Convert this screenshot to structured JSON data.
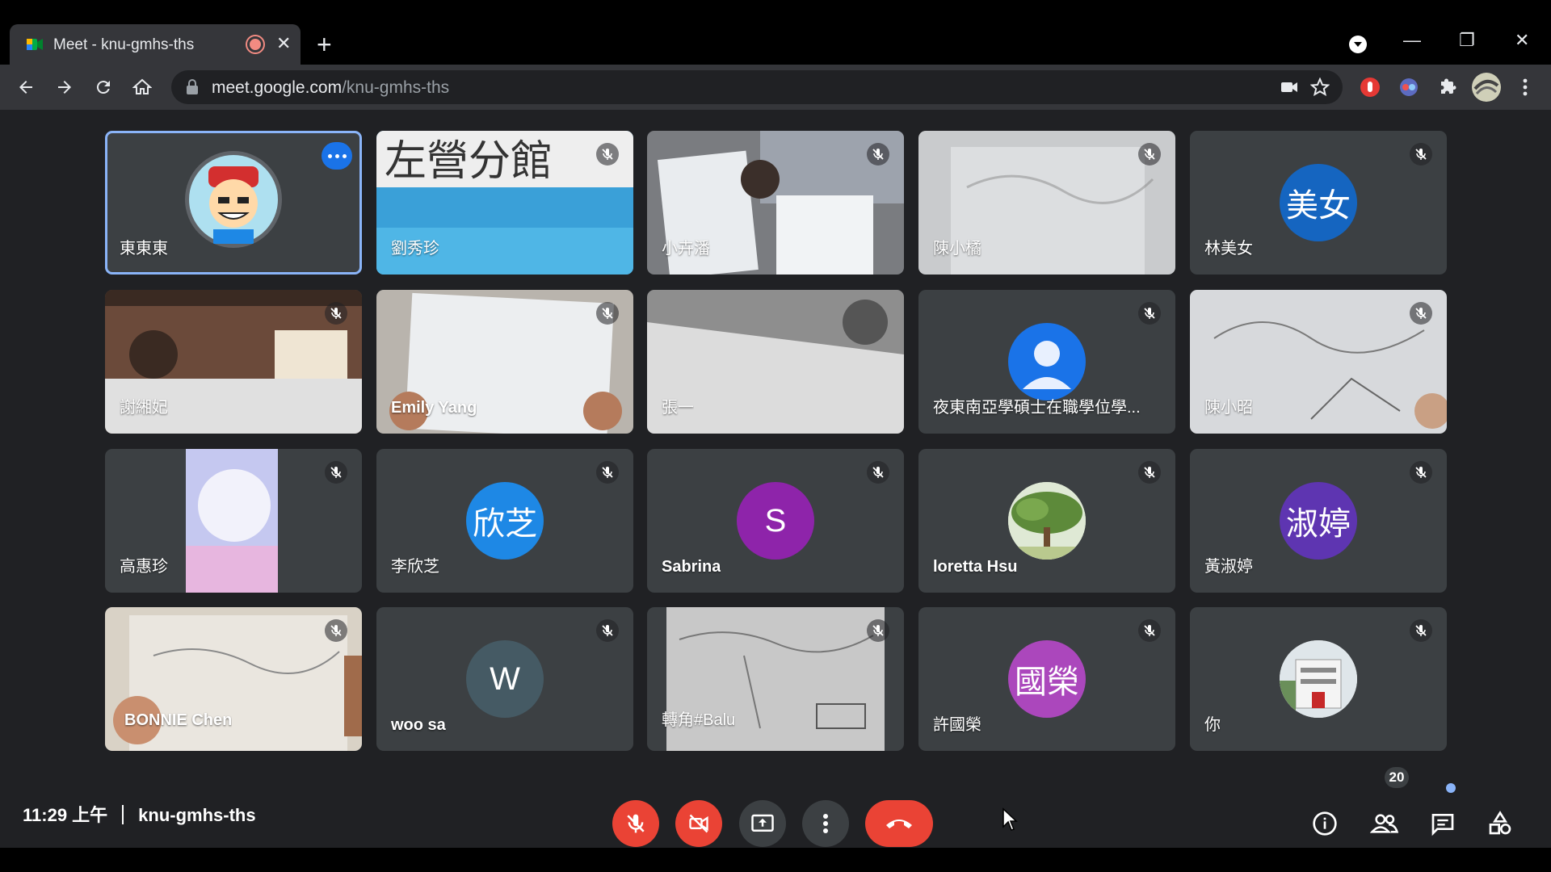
{
  "browser": {
    "tab_title": "Meet - knu-gmhs-ths",
    "tab_close": "✕",
    "new_tab": "+",
    "url_host": "meet.google.com",
    "url_path": "/knu-gmhs-ths",
    "window_controls": {
      "minimize": "—",
      "restore": "❐",
      "close": "✕"
    }
  },
  "participants": [
    {
      "name": "東東東",
      "muted": false,
      "active": true,
      "feed": "avatar-image"
    },
    {
      "name": "劉秀珍",
      "muted": true,
      "feed": "video"
    },
    {
      "name": "小卉潘",
      "muted": true,
      "feed": "video"
    },
    {
      "name": "陳小橘",
      "muted": true,
      "feed": "video"
    },
    {
      "name": "林美女",
      "muted": true,
      "feed": "initials",
      "initials": "美女",
      "color": "#1565c0"
    },
    {
      "name": "謝緗妃",
      "muted": true,
      "feed": "video"
    },
    {
      "name": "Emily Yang",
      "muted": true,
      "feed": "video"
    },
    {
      "name": "張一",
      "muted": false,
      "feed": "video"
    },
    {
      "name": "夜東南亞學碩士在職學位學...",
      "muted": true,
      "feed": "placeholder",
      "color": "#1a73e8"
    },
    {
      "name": "陳小昭",
      "muted": true,
      "feed": "video"
    },
    {
      "name": "高惠珍",
      "muted": true,
      "feed": "video"
    },
    {
      "name": "李欣芝",
      "muted": true,
      "feed": "initials",
      "initials": "欣芝",
      "color": "#1e88e5"
    },
    {
      "name": "Sabrina",
      "muted": true,
      "feed": "initials",
      "initials": "S",
      "color": "#8e24aa"
    },
    {
      "name": "loretta Hsu",
      "muted": true,
      "feed": "avatar-image"
    },
    {
      "name": "黃淑婷",
      "muted": true,
      "feed": "initials",
      "initials": "淑婷",
      "color": "#5e35b1"
    },
    {
      "name": "BONNIE Chen",
      "muted": true,
      "feed": "video"
    },
    {
      "name": "woo sa",
      "muted": true,
      "feed": "initials",
      "initials": "W",
      "color": "#455a64"
    },
    {
      "name": "轉角#Balu",
      "muted": true,
      "feed": "video"
    },
    {
      "name": "許國榮",
      "muted": true,
      "feed": "initials",
      "initials": "國榮",
      "color": "#ab47bc"
    },
    {
      "name": "你",
      "muted": true,
      "feed": "avatar-image"
    }
  ],
  "bottom_bar": {
    "time": "11:29 上午",
    "meeting_code": "knu-gmhs-ths",
    "participant_count": "20"
  },
  "colors": {
    "meet_bg": "#202124",
    "tile_bg": "#3c4043",
    "active_border": "#8ab4f8",
    "danger": "#ea4335"
  }
}
